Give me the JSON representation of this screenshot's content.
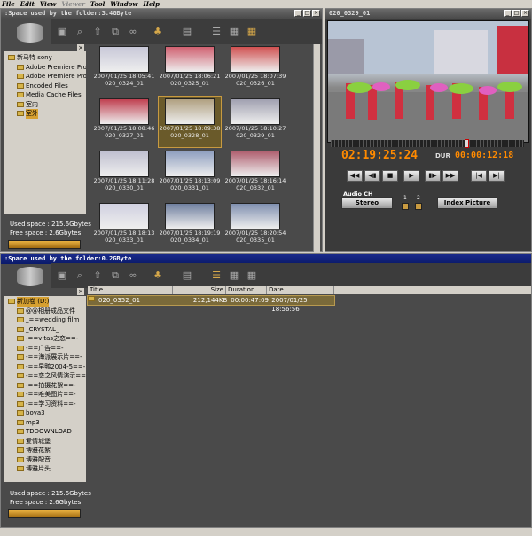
{
  "menu": [
    "File",
    "Edit",
    "View",
    "Viewer",
    "Tool",
    "Window",
    "Help"
  ],
  "menu_disabled": [
    false,
    false,
    false,
    true,
    false,
    false,
    false
  ],
  "top_window": {
    "title": ":Space used by the folder:3.4GByte",
    "tree": [
      {
        "label": "新马特 sony",
        "indent": 0,
        "sel": false
      },
      {
        "label": "Adobe Premiere Pro A",
        "indent": 1,
        "sel": false
      },
      {
        "label": "Adobe Premiere Pro F",
        "indent": 1,
        "sel": false
      },
      {
        "label": "Encoded Files",
        "indent": 1,
        "sel": false
      },
      {
        "label": "Media Cache Files",
        "indent": 1,
        "sel": false
      },
      {
        "label": "室内",
        "indent": 1,
        "sel": false
      },
      {
        "label": "室外",
        "indent": 1,
        "sel": true
      }
    ],
    "used_space": "Used space : 215.6Gbytes",
    "free_space": "Free space : 2.6Gbytes",
    "thumbs": [
      {
        "date": "2007/01/25 18:05:41",
        "name": "020_0324_01",
        "color": "#c8c8d8",
        "sel": false
      },
      {
        "date": "2007/01/25 18:06:21",
        "name": "020_0325_01",
        "color": "#d06070",
        "sel": false
      },
      {
        "date": "2007/01/25 18:07:39",
        "name": "020_0326_01",
        "color": "#d05050",
        "sel": false
      },
      {
        "date": "2007/01/25 18:08:46",
        "name": "020_0327_01",
        "color": "#c04050",
        "sel": false
      },
      {
        "date": "2007/01/25 18:09:38",
        "name": "020_0328_01",
        "color": "#b0a080",
        "sel": true
      },
      {
        "date": "2007/01/25 18:10:27",
        "name": "020_0329_01",
        "color": "#a0a0b0",
        "sel": false
      },
      {
        "date": "2007/01/25 18:11:28",
        "name": "020_0330_01",
        "color": "#c0c0d0",
        "sel": false
      },
      {
        "date": "2007/01/25 18:13:09",
        "name": "020_0331_01",
        "color": "#90a0c0",
        "sel": false
      },
      {
        "date": "2007/01/25 18:16:14",
        "name": "020_0332_01",
        "color": "#b06070",
        "sel": false
      },
      {
        "date": "2007/01/25 18:18:13",
        "name": "020_0333_01",
        "color": "#d0d0e0",
        "sel": false
      },
      {
        "date": "2007/01/25 18:19:19",
        "name": "020_0334_01",
        "color": "#7080a0",
        "sel": false
      },
      {
        "date": "2007/01/25 18:20:54",
        "name": "020_0335_01",
        "color": "#8090b0",
        "sel": false
      }
    ]
  },
  "viewer": {
    "title": "020_0329_01",
    "timecode": "02:19:25:24",
    "dur_label": "DUR",
    "duration": "00:00:12:18",
    "audio_label": "Audio CH",
    "stereo_label": "Stereo",
    "ch1": "1",
    "ch2": "2",
    "index_label": "Index Picture",
    "controls": [
      "◀◀",
      "◀▮",
      "■",
      "▶",
      "▮▶",
      "▶▶",
      "|◀",
      "▶|"
    ],
    "playhead_fraction": 0.71
  },
  "bottom_window": {
    "title": ":Space used by the folder:0.2GByte",
    "tree": [
      {
        "label": "新加卷 (D:)",
        "indent": 0,
        "sel": true
      },
      {
        "label": "@@相册成品文件",
        "indent": 1,
        "sel": false
      },
      {
        "label": "_==wedding film",
        "indent": 1,
        "sel": false
      },
      {
        "label": "_CRYSTAL_",
        "indent": 1,
        "sel": false
      },
      {
        "label": "-==vitas之恋==-",
        "indent": 1,
        "sel": false
      },
      {
        "label": "-==广告==-",
        "indent": 1,
        "sel": false
      },
      {
        "label": "-==海派展示片==-",
        "indent": 1,
        "sel": false
      },
      {
        "label": "-==早鸭2004-5==-",
        "indent": 1,
        "sel": false
      },
      {
        "label": "-==恋之风情演示==",
        "indent": 1,
        "sel": false
      },
      {
        "label": "-==拍摄花絮==-",
        "indent": 1,
        "sel": false
      },
      {
        "label": "-==唯美图片==-",
        "indent": 1,
        "sel": false
      },
      {
        "label": "-==学习资料==-",
        "indent": 1,
        "sel": false
      },
      {
        "label": "boya3",
        "indent": 1,
        "sel": false
      },
      {
        "label": "mp3",
        "indent": 1,
        "sel": false
      },
      {
        "label": "TDDOWNLOAD",
        "indent": 1,
        "sel": false
      },
      {
        "label": "爱情城堡",
        "indent": 1,
        "sel": false
      },
      {
        "label": "博雅花絮",
        "indent": 1,
        "sel": false
      },
      {
        "label": "博雅配音",
        "indent": 1,
        "sel": false
      },
      {
        "label": "博雅片头",
        "indent": 1,
        "sel": false
      }
    ],
    "used_space": "Used space : 215.6Gbytes",
    "free_space": "Free space : 2.6Gbytes",
    "columns": [
      "Title",
      "Size",
      "Duration",
      "Date"
    ],
    "rows": [
      {
        "title": "020_0352_01",
        "size": "212,144KB",
        "duration": "00:00:47:09",
        "date": "2007/01/25 18:56:56"
      }
    ]
  },
  "colors": {
    "accent": "#ff8a00",
    "selection": "#d6a030",
    "panel": "#4a4a4a"
  }
}
